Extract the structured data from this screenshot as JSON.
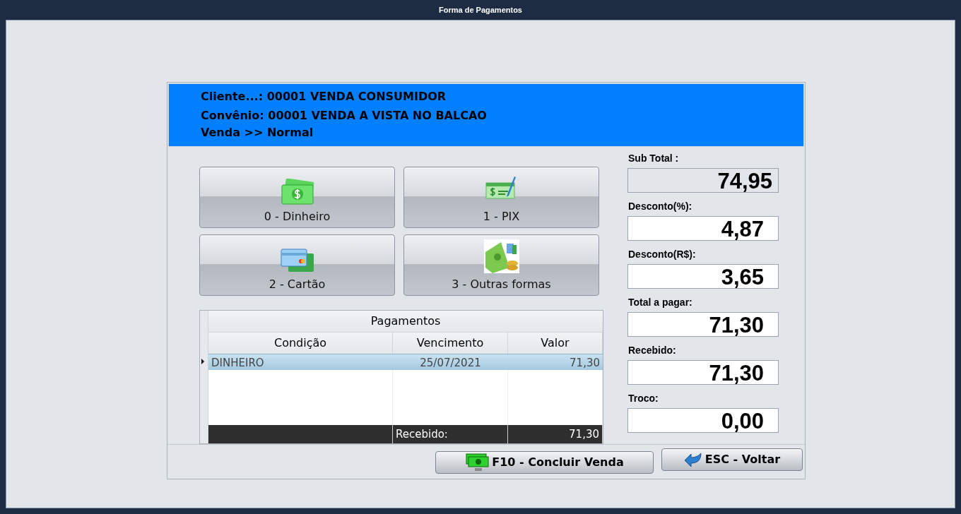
{
  "window": {
    "title": "Forma de Pagamentos"
  },
  "header": {
    "lines": [
      "Cliente...: 00001 VENDA CONSUMIDOR",
      "Convênio: 00001 VENDA A VISTA NO BALCAO",
      "Venda >> Normal"
    ]
  },
  "payment_buttons": [
    {
      "kind": "cash",
      "label": "0 - Dinheiro"
    },
    {
      "kind": "pix",
      "label": "1 - PIX"
    },
    {
      "kind": "card",
      "label": "2 - Cartão"
    },
    {
      "kind": "other",
      "label": "3 - Outras formas"
    }
  ],
  "payments": {
    "title": "Pagamentos",
    "columns": [
      "Condição",
      "Vencimento",
      "Valor"
    ],
    "rows": [
      {
        "cells": [
          "DINHEIRO",
          "25/07/2021",
          "71,30"
        ],
        "selected": true
      }
    ],
    "footer": {
      "label": "Recebido:",
      "value": "71,30"
    }
  },
  "totals": [
    {
      "label": "Sub Total :",
      "value": "74,95",
      "readonly": true
    },
    {
      "label": "Desconto(%):",
      "value": "4,87",
      "readonly": false
    },
    {
      "label": "Desconto(R$):",
      "value": "3,65",
      "readonly": false
    },
    {
      "label": "Total a pagar:",
      "value": "71,30",
      "readonly": false
    },
    {
      "label": "Recebido:",
      "value": "71,30",
      "readonly": false
    },
    {
      "label": "Troco:",
      "value": "0,00",
      "readonly": false
    }
  ],
  "actions": [
    {
      "kind": "confirm",
      "label": "F10 - Concluir Venda"
    },
    {
      "kind": "back",
      "label": "ESC - Voltar"
    }
  ]
}
